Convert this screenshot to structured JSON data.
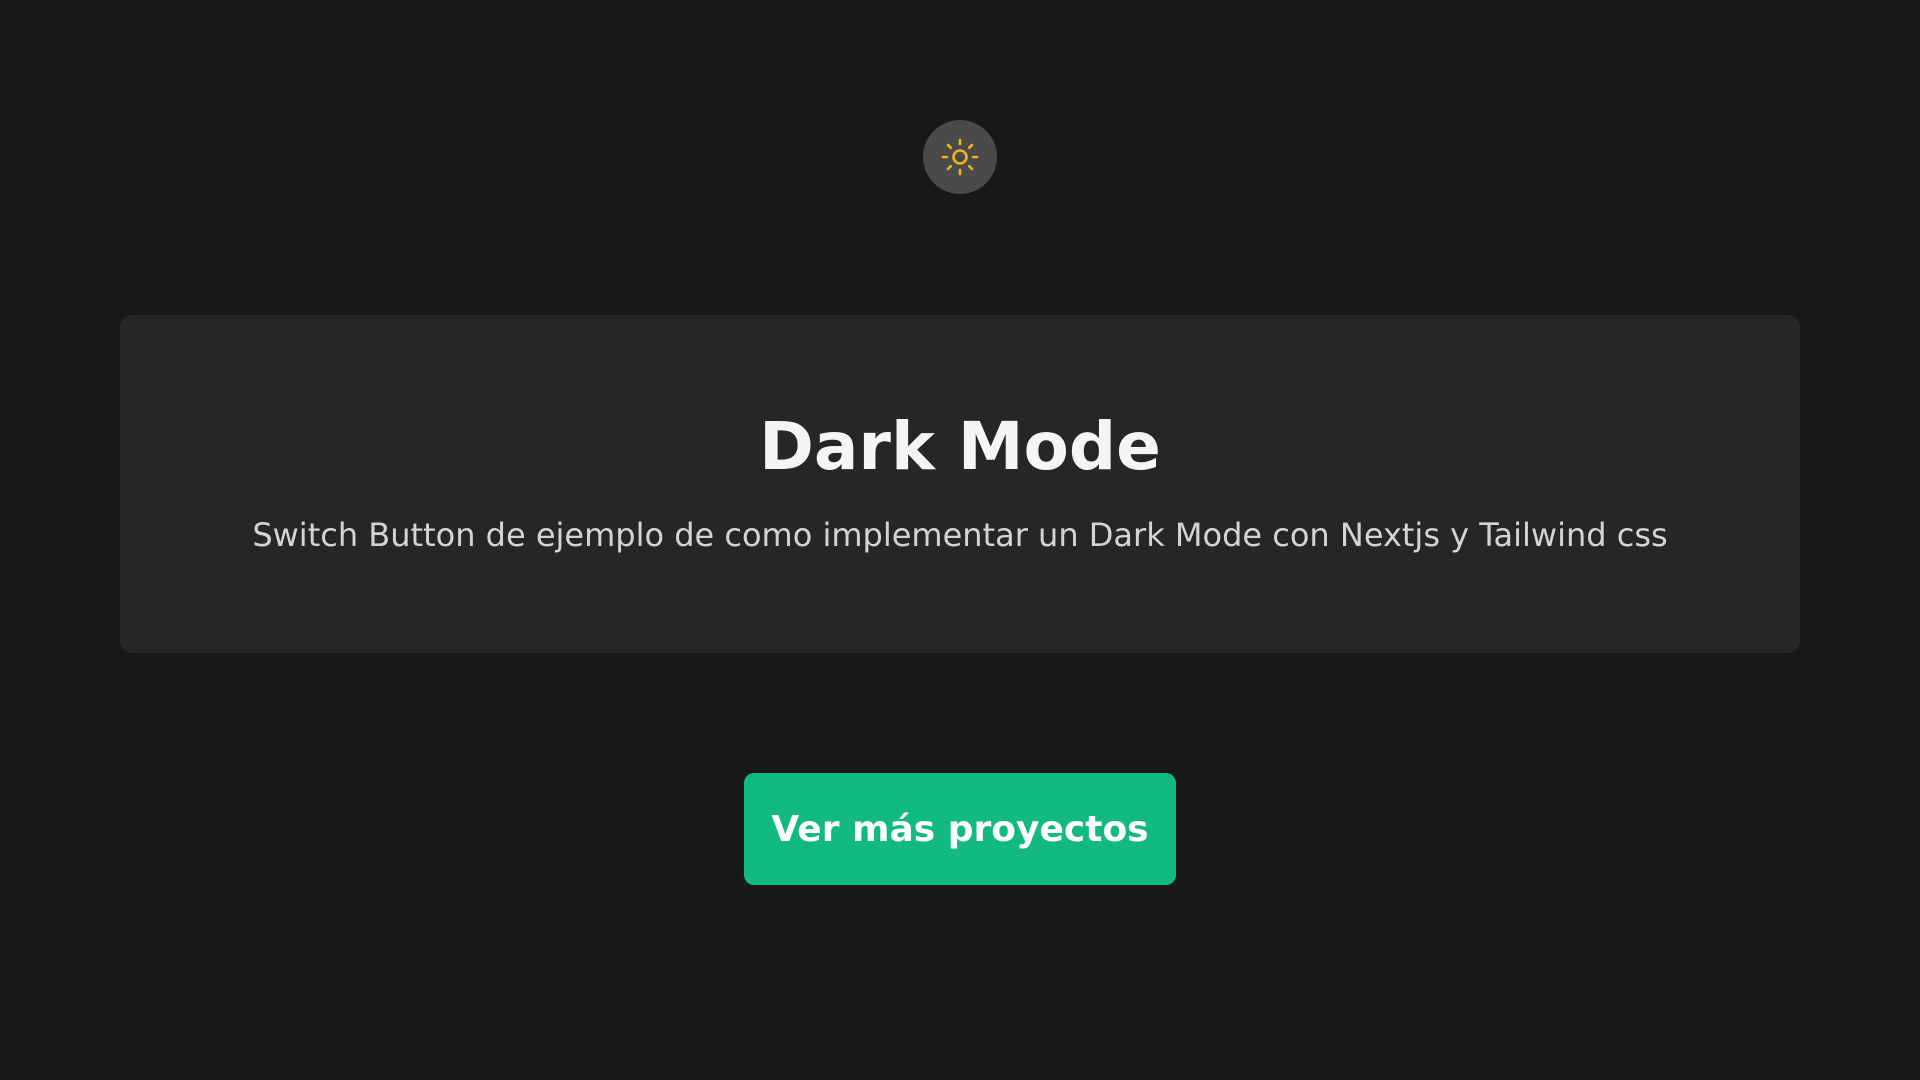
{
  "theme_toggle": {
    "icon": "sun-icon",
    "icon_color": "#f0b11d",
    "background": "#4a4a4a"
  },
  "card": {
    "title": "Dark Mode",
    "description": "Switch Button de ejemplo de como implementar un Dark Mode con Nextjs y Tailwind css"
  },
  "cta": {
    "label": "Ver más proyectos",
    "color": "#12b981"
  },
  "colors": {
    "page_background": "#181818",
    "card_background": "#262626"
  }
}
